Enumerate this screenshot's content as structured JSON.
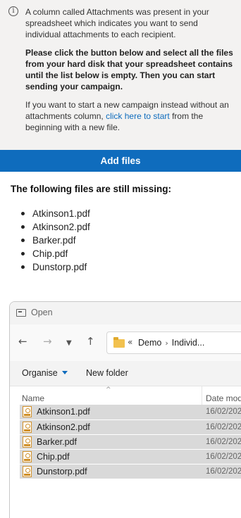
{
  "info": {
    "paragraph1": "A column called Attachments was present in your spreadsheet which indicates you want to send individual attachments to each recipient.",
    "paragraph2": "Please click the button below and select all the files from your hard disk that your spreadsheet contains until the list below is empty. Then you can start sending your campaign.",
    "paragraph3_before": "If you want to start a new campaign instead without an attachments column, ",
    "paragraph3_link": "click here to start",
    "paragraph3_after": " from the beginning with a new file."
  },
  "add_files_label": "Add files",
  "missing": {
    "heading": "The following files are still missing:",
    "files": [
      "Atkinson1.pdf",
      "Atkinson2.pdf",
      "Barker.pdf",
      "Chip.pdf",
      "Dunstorp.pdf"
    ]
  },
  "dialog": {
    "title": "Open",
    "breadcrumb": {
      "chevron": "«",
      "first": "Demo",
      "second": "Individ..."
    },
    "toolbar": {
      "organise": "Organise",
      "new_folder": "New folder"
    },
    "columns": {
      "name": "Name",
      "date": "Date mod"
    },
    "rows": [
      {
        "name": "Atkinson1.pdf",
        "date": "16/02/202"
      },
      {
        "name": "Atkinson2.pdf",
        "date": "16/02/202"
      },
      {
        "name": "Barker.pdf",
        "date": "16/02/202"
      },
      {
        "name": "Chip.pdf",
        "date": "16/02/202"
      },
      {
        "name": "Dunstorp.pdf",
        "date": "16/02/202"
      }
    ]
  }
}
